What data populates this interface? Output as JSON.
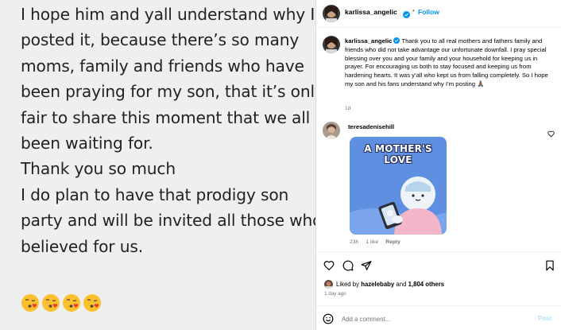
{
  "story": {
    "lines": [
      "I hope him and yall understand why I",
      "posted it, because there’s so many",
      "moms, family and friends who have",
      "been praying for my son, that it’s only",
      "fair to share this moment that we all",
      "been waiting for.",
      "Thank you so much",
      "I do plan to have that prodigy son",
      "party and will be invited all those who",
      "believed for us."
    ],
    "emojis": [
      "kissing-face-with-heart",
      "kissing-face-with-heart",
      "kissing-face-with-heart",
      "kissing-face-with-heart"
    ]
  },
  "post": {
    "header": {
      "username": "karlissa_angelic",
      "separator": "•",
      "follow_label": "Follow"
    },
    "caption": {
      "username": "karlissa_angelic",
      "text": "Thank you to all real mothers and fathers family and friends who did not take advantage our unfortunate downfall. I pray special blessing over you and your family and your household for keeping us in prayer. For encouraging us both to stay focused and keeping us from hardening hearts. It was y’all who kept us from falling completely. So I hope my son and his fans understand why I’m posting 🙏🏾",
      "time": "1d"
    },
    "comment": {
      "username": "teresadenisehill",
      "image_title": "A MOTHER'S LOVE",
      "time": "23h",
      "likes": "1 like",
      "reply_label": "Reply"
    },
    "likes": {
      "prefix": "Liked by ",
      "user": "hazelebaby",
      "middle": " and ",
      "count": "1,804 others"
    },
    "date": "1 day ago",
    "add_comment": {
      "placeholder": "Add a comment...",
      "post_label": "Post"
    }
  },
  "colors": {
    "link_blue": "#0095f6",
    "post_disabled": "#b2dffc",
    "muted": "#737373",
    "story_bg": "#efefef"
  },
  "icons": {
    "like": "heart-outline-icon",
    "comment": "speech-bubble-icon",
    "share": "paper-plane-icon",
    "save": "bookmark-icon",
    "emoji": "smiley-icon",
    "verified": "verified-badge-icon"
  }
}
